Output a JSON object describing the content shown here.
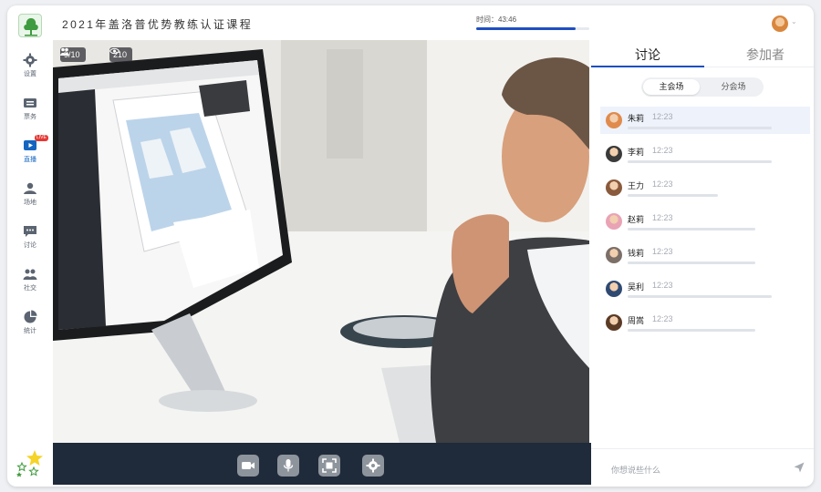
{
  "header": {
    "course_title": "2021年盖洛普优势教练认证课程",
    "timer_label": "时间：43:46",
    "timer_progress": 0.88
  },
  "sidebar": {
    "items": [
      {
        "label": "设置",
        "icon": "gear-icon",
        "active": false
      },
      {
        "label": "票务",
        "icon": "ticket-icon",
        "active": false
      },
      {
        "label": "直播",
        "icon": "live-icon",
        "active": true,
        "badge": "LIVE"
      },
      {
        "label": "场地",
        "icon": "venue-icon",
        "active": false
      },
      {
        "label": "讨论",
        "icon": "chat-icon",
        "active": false
      },
      {
        "label": "社交",
        "icon": "people-icon",
        "active": false
      },
      {
        "label": "统计",
        "icon": "pie-chart-icon",
        "active": false
      }
    ]
  },
  "video": {
    "participants": "9/10",
    "viewers": "210"
  },
  "controls": [
    "camera-icon",
    "microphone-icon",
    "screen-share-icon",
    "settings-icon"
  ],
  "panel": {
    "tabs": [
      "讨论",
      "参加者"
    ],
    "active_tab": "讨论",
    "segments": [
      "主会场",
      "分会场"
    ],
    "active_segment": "主会场",
    "messages": [
      {
        "name": "朱莉",
        "time": "12:23",
        "color": "#e08b4c",
        "bar": 0.86
      },
      {
        "name": "李莉",
        "time": "12:23",
        "color": "#3a3a3a",
        "bar": 0.86
      },
      {
        "name": "王力",
        "time": "12:23",
        "color": "#8a5a3c",
        "bar": 0.54
      },
      {
        "name": "赵莉",
        "time": "12:23",
        "color": "#e9a3b5",
        "bar": 0.76
      },
      {
        "name": "钱莉",
        "time": "12:23",
        "color": "#7c6f68",
        "bar": 0.76
      },
      {
        "name": "吴利",
        "time": "12:23",
        "color": "#2f4a72",
        "bar": 0.86
      },
      {
        "name": "周嵩",
        "time": "12:23",
        "color": "#5b3a26",
        "bar": 0.76
      }
    ],
    "input_placeholder": "你想说些什么"
  },
  "colors": {
    "accent": "#1e4fc1",
    "control_bar": "#1f2a3a",
    "highlight_row": "#edf2fb"
  }
}
